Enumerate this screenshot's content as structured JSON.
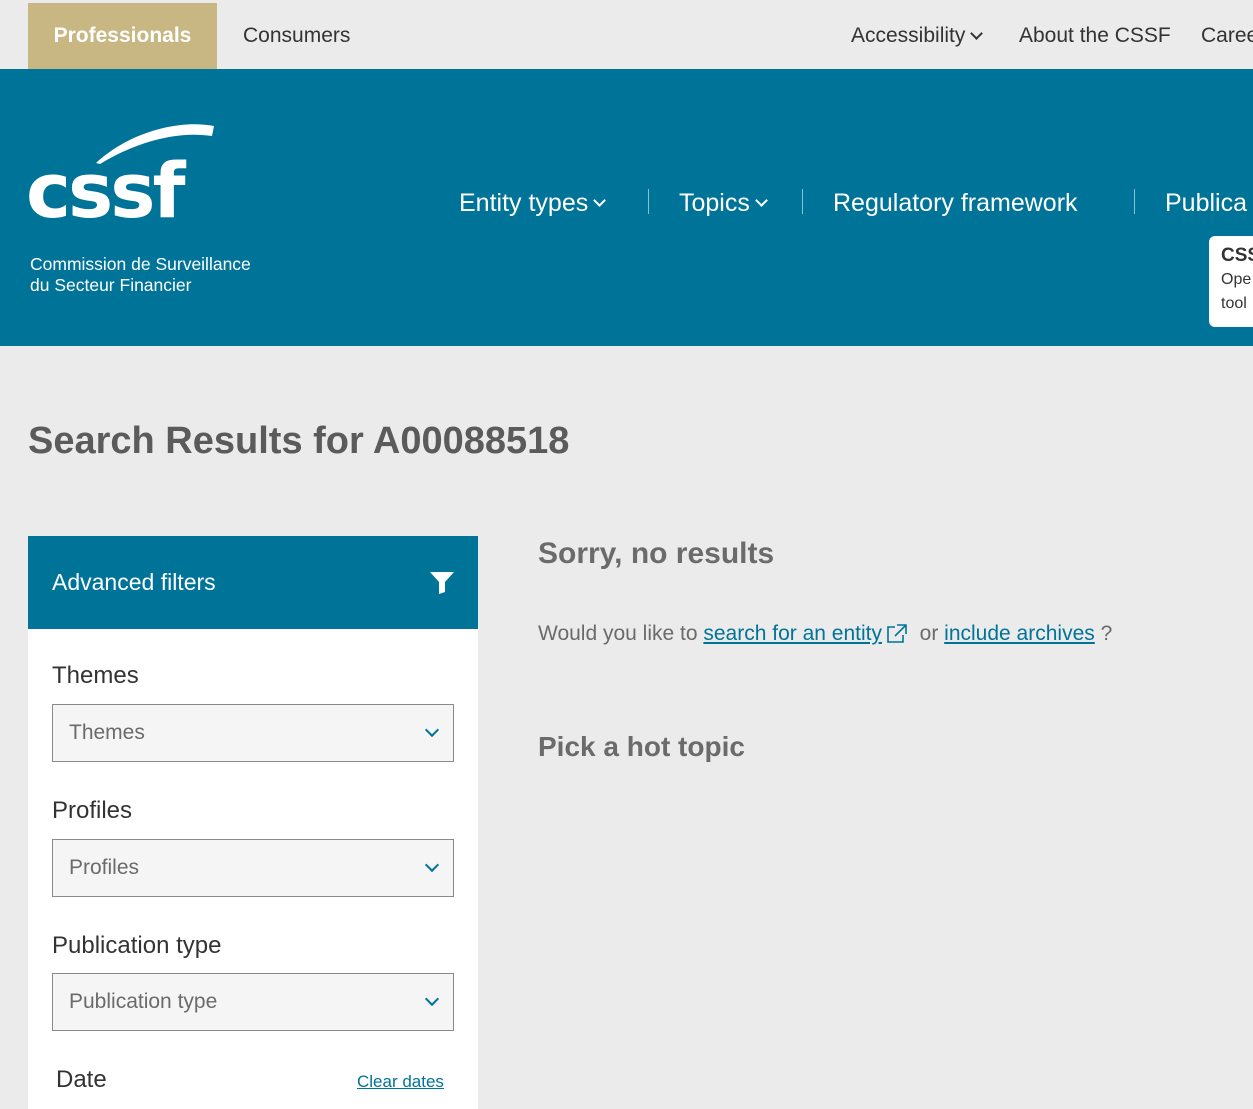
{
  "topbar": {
    "tabs": [
      {
        "label": "Professionals",
        "active": true
      },
      {
        "label": "Consumers",
        "active": false
      }
    ],
    "utility_links": [
      {
        "label": "Accessibility",
        "dropdown": true
      },
      {
        "label": "About the CSSF",
        "dropdown": false
      },
      {
        "label": "Caree",
        "dropdown": false
      }
    ]
  },
  "header": {
    "logo_word": "cssf",
    "logo_sub_line1": "Commission de Surveillance",
    "logo_sub_line2": "du Secteur Financier",
    "nav": [
      {
        "label": "Entity types",
        "dropdown": true
      },
      {
        "label": "Topics",
        "dropdown": true
      },
      {
        "label": "Regulatory framework",
        "dropdown": false
      },
      {
        "label": "Publica",
        "dropdown": false
      }
    ],
    "popup": {
      "title": "CSS",
      "line1": "Ope",
      "line2": "tool"
    }
  },
  "main": {
    "title": "Search Results for A00088518",
    "no_results": "Sorry, no results",
    "suggest_prefix": "Would you like to",
    "suggest_link1": "search for an entity",
    "suggest_or": "or",
    "suggest_link2": "include archives",
    "suggest_suffix": "?",
    "hot_topic": "Pick a hot topic"
  },
  "filters": {
    "header": "Advanced filters",
    "themes_label": "Themes",
    "themes_placeholder": "Themes",
    "profiles_label": "Profiles",
    "profiles_placeholder": "Profiles",
    "pubtype_label": "Publication type",
    "pubtype_placeholder": "Publication type",
    "date_label": "Date",
    "clear_dates": "Clear dates"
  },
  "colors": {
    "brand_blue": "#007399",
    "gold": "#c8b783",
    "background": "#ebebeb"
  },
  "icons": [
    "chevron-down-icon",
    "filter-icon",
    "external-link-icon",
    "cssf-logo"
  ]
}
